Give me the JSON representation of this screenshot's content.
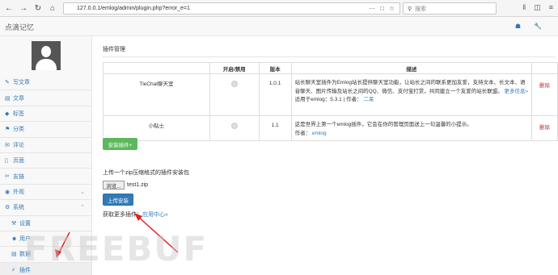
{
  "browser": {
    "url": "127.0.0.1/emlog/admin/plugin.php?error_e=1",
    "search_placeholder": "搜索"
  },
  "header": {
    "brand": "点滴记忆"
  },
  "sidebar": {
    "items": [
      {
        "label": "写文章",
        "icon": "pencil-icon"
      },
      {
        "label": "文章",
        "icon": "file-icon"
      },
      {
        "label": "标签",
        "icon": "tag-icon"
      },
      {
        "label": "分类",
        "icon": "flag-icon"
      },
      {
        "label": "评论",
        "icon": "comment-icon"
      },
      {
        "label": "页面",
        "icon": "page-icon"
      },
      {
        "label": "友链",
        "icon": "link-icon"
      },
      {
        "label": "外观",
        "icon": "eye-icon"
      },
      {
        "label": "系统",
        "icon": "gear-icon"
      },
      {
        "label": "设置",
        "icon": "wrench-icon"
      },
      {
        "label": "用户",
        "icon": "user-icon"
      },
      {
        "label": "数据",
        "icon": "database-icon"
      },
      {
        "label": "插件",
        "icon": "plug-icon"
      }
    ]
  },
  "main": {
    "title": "插件管理",
    "table": {
      "headers": [
        "",
        "开启/禁用",
        "版本",
        "描述",
        ""
      ],
      "rows": [
        {
          "name": "TleChat聊天室",
          "version": "1.0.1",
          "description": "站长聊天室插件为Emlog站长提供聊天室功能，让站长之间的联系更加友爱，支持文本、长文本、语音聊天、图片传输及站长之间的QQ、微信、支付宝打赏，共同建立一个友爱的站长联盟。",
          "more": "更多信息»",
          "meta": "适用于emlog：5.3.1 | 作者：",
          "author": "二呆",
          "delete": "删除"
        },
        {
          "name": "小贴士",
          "version": "1.1",
          "description": "这是世界上第一个emlog插件，它会在你的管理页面送上一句温馨的小提示。",
          "more": "",
          "meta": "作者：",
          "author": "emlog",
          "delete": "删除"
        }
      ]
    },
    "install_button": "安装插件+",
    "upload_hint": "上传一个zip压缩格式的插件安装包",
    "browse_button": "浏览...",
    "file_name": "test1.zip",
    "upload_button": "上传安装",
    "more_plugins_label": "获取更多插件：",
    "more_plugins_link": "应用中心»"
  },
  "watermark": "FREEBUF",
  "colors": {
    "link": "#337ab7",
    "success": "#5cb85c",
    "danger": "#c9302c",
    "annotation_arrow": "#e02020"
  }
}
